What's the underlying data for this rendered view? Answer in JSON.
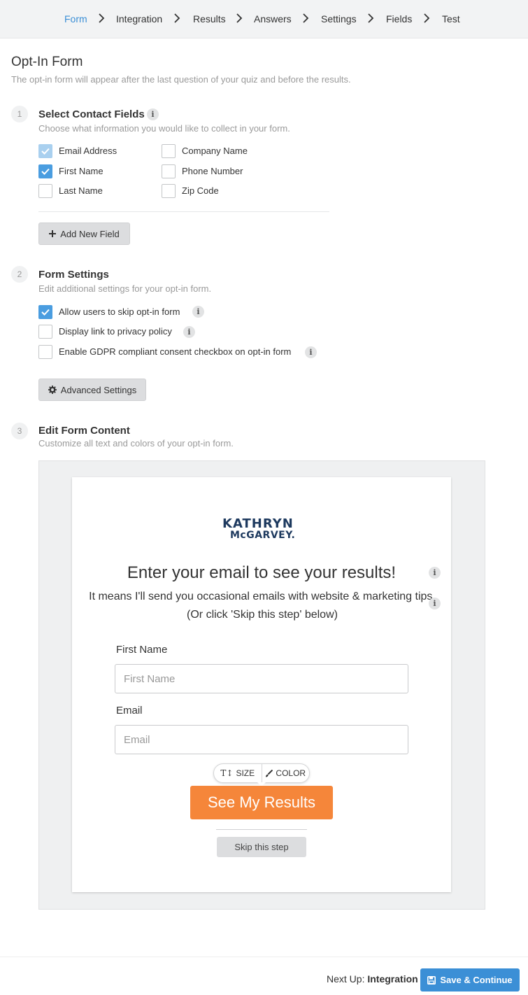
{
  "nav": {
    "steps": [
      "Form",
      "Integration",
      "Results",
      "Answers",
      "Settings",
      "Fields",
      "Test"
    ],
    "active": "Form"
  },
  "page": {
    "title": "Opt-In Form",
    "subtitle": "The opt-in form will appear after the last question of your quiz and before the results."
  },
  "contact_fields": {
    "number": "1",
    "title": "Select Contact Fields",
    "subtitle": "Choose what information you would like to collect in your form.",
    "options": [
      {
        "label": "Email Address",
        "checked": true,
        "locked": true
      },
      {
        "label": "First Name",
        "checked": true
      },
      {
        "label": "Last Name",
        "checked": false
      },
      {
        "label": "Company Name",
        "checked": false
      },
      {
        "label": "Phone Number",
        "checked": false
      },
      {
        "label": "Zip Code",
        "checked": false
      }
    ],
    "add_button": "Add New Field"
  },
  "form_settings": {
    "number": "2",
    "title": "Form Settings",
    "subtitle": "Edit additional settings for your opt-in form.",
    "options": [
      {
        "label": "Allow users to skip opt-in form",
        "checked": true
      },
      {
        "label": "Display link to privacy policy",
        "checked": false
      },
      {
        "label": "Enable GDPR compliant consent checkbox on opt-in form",
        "checked": false
      }
    ],
    "advanced_button": "Advanced Settings"
  },
  "form_content": {
    "number": "3",
    "title": "Edit Form Content",
    "subtitle": "Customize all text and colors of your opt-in form."
  },
  "preview": {
    "logo_line1": "KATHRYN",
    "logo_line2": "McGARVEY.",
    "headline": "Enter your email to see your results!",
    "body": "It means I'll send you occasional emails with website & marketing tips. (Or click 'Skip this step' below)",
    "fields": [
      {
        "label": "First Name",
        "placeholder": "First Name"
      },
      {
        "label": "Email",
        "placeholder": "Email"
      }
    ],
    "toolbar_size": "SIZE",
    "toolbar_color": "COLOR",
    "cta": "See My Results",
    "skip": "Skip this step"
  },
  "footer": {
    "next_up_prefix": "Next Up:",
    "next_up_target": "Integration",
    "save_button": "Save & Continue"
  },
  "colors": {
    "accent": "#3b8fd6",
    "cta": "#f5863a",
    "logo": "#1e3a5f"
  },
  "info_glyph": "i"
}
